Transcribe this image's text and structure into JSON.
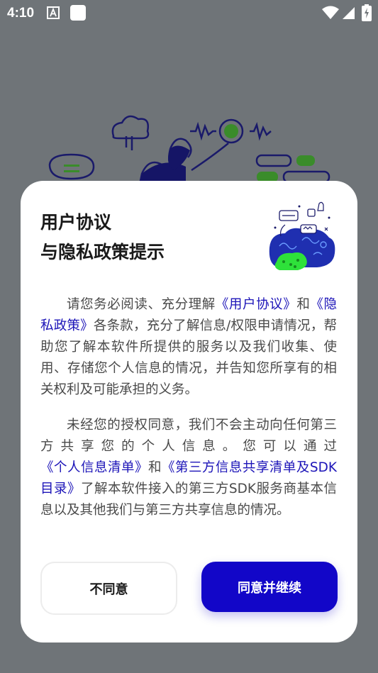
{
  "status_bar": {
    "time": "4:10"
  },
  "dialog": {
    "title_line1": "用户协议",
    "title_line2": "与隐私政策提示",
    "para1": {
      "text1": "请您务必阅读、充分理解",
      "link1": "《用户协议》",
      "text2": "和",
      "link2": "《隐私政策》",
      "text3": "各条款，充分了解信息/权限申请情况，帮助您了解本软件所提供的服务以及我们收集、使用、存储您个人信息的情况，并告知您所享有的相关权利及可能承担的义务。"
    },
    "para2": {
      "text1": "未经您的授权同意，我们不会主动向任何第三方共享您的个人信息。您可以通过",
      "link1": "《个人信息清单》",
      "text2": "和",
      "link2": "《第三方信息共享清单及SDK目录》",
      "text3": "了解本软件接入的第三方SDK服务商基本信息以及其他我们与第三方共享信息的情况。"
    },
    "disagree_label": "不同意",
    "agree_label": "同意并继续"
  },
  "colors": {
    "accent": "#1206c8",
    "link": "#1c14b8",
    "scrim": "#6f7478"
  },
  "icons": [
    "a-notification-icon",
    "app-notification-icon",
    "wifi-icon",
    "cell-signal-icon",
    "battery-icon"
  ]
}
